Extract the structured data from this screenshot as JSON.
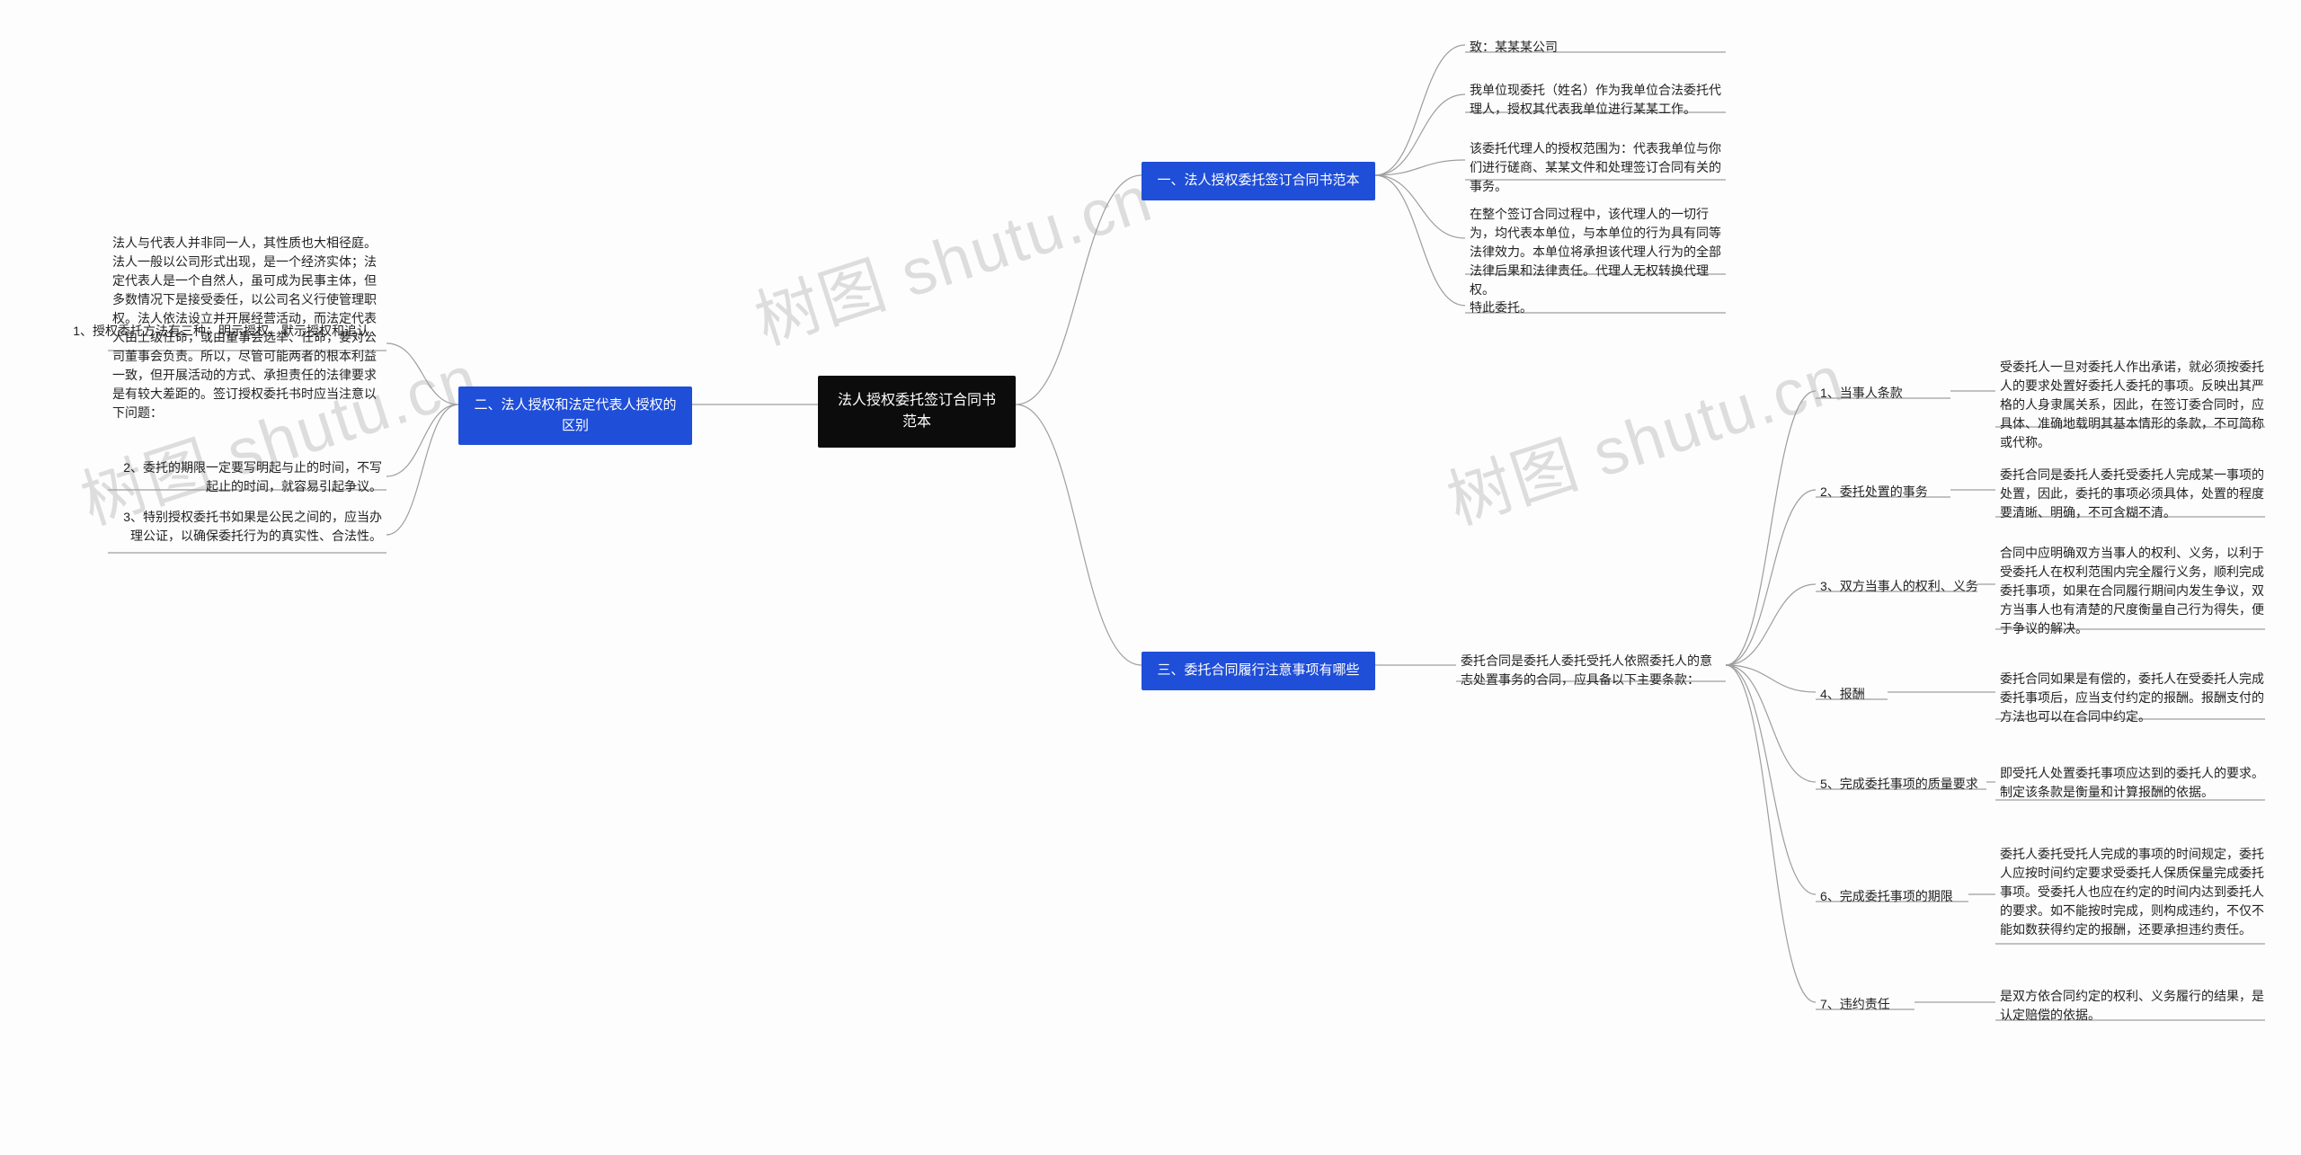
{
  "watermark": "树图 shutu.cn",
  "root": "法人授权委托签订合同书范本",
  "branches": {
    "b1": {
      "title": "一、法人授权委托签订合同书范本",
      "children": [
        "致：某某某公司",
        "我单位现委托（姓名）作为我单位合法委托代理人，授权其代表我单位进行某某工作。",
        "该委托代理人的授权范围为：代表我单位与你们进行磋商、某某文件和处理签订合同有关的事务。",
        "在整个签订合同过程中，该代理人的一切行为，均代表本单位，与本单位的行为具有同等法律效力。本单位将承担该代理人行为的全部法律后果和法律责任。代理人无权转换代理权。",
        "特此委托。"
      ]
    },
    "b2": {
      "title": "二、法人授权和法定代表人授权的区别",
      "desc": "法人与代表人并非同一人，其性质也大相径庭。法人一般以公司形式出现，是一个经济实体；法定代表人是一个自然人，虽可成为民事主体，但多数情况下是接受委任，以公司名义行使管理职权。法人依法设立并开展经营活动，而法定代表人由上级任命，或由董事会选举、任命，要对公司董事会负责。所以，尽管可能两者的根本利益一致，但开展活动的方式、承担责任的法律要求是有较大差距的。签订授权委托书时应当注意以下问题：",
      "children": [
        "1、授权委托方法有三种：明示授权、默示授权和追认。",
        "2、委托的期限一定要写明起与止的时间，不写起止的时间，就容易引起争议。",
        "3、特别授权委托书如果是公民之间的，应当办理公证，以确保委托行为的真实性、合法性。"
      ]
    },
    "b3": {
      "title": "三、委托合同履行注意事项有哪些",
      "intro": "委托合同是委托人委托受托人依照委托人的意志处置事务的合同，应具备以下主要条款：",
      "items": [
        {
          "k": "1、当事人条款",
          "v": "受委托人一旦对委托人作出承诺，就必须按委托人的要求处置好委托人委托的事项。反映出其严格的人身隶属关系，因此，在签订委合同时，应具体、准确地载明其基本情形的条款，不可简称或代称。"
        },
        {
          "k": "2、委托处置的事务",
          "v": "委托合同是委托人委托受委托人完成某一事项的处置，因此，委托的事项必须具体，处置的程度要清晰、明确，不可含糊不清。"
        },
        {
          "k": "3、双方当事人的权利、义务",
          "v": "合同中应明确双方当事人的权利、义务，以利于受委托人在权利范围内完全履行义务，顺利完成委托事项，如果在合同履行期间内发生争议，双方当事人也有清楚的尺度衡量自己行为得失，便于争议的解决。"
        },
        {
          "k": "4、报酬",
          "v": "委托合同如果是有偿的，委托人在受委托人完成委托事项后，应当支付约定的报酬。报酬支付的方法也可以在合同中约定。"
        },
        {
          "k": "5、完成委托事项的质量要求",
          "v": "即受托人处置委托事项应达到的委托人的要求。制定该条款是衡量和计算报酬的依据。"
        },
        {
          "k": "6、完成委托事项的期限",
          "v": "委托人委托受托人完成的事项的时间规定，委托人应按时间约定要求受委托人保质保量完成委托事项。受委托人也应在约定的时间内达到委托人的要求。如不能按时完成，则构成违约，不仅不能如数获得约定的报酬，还要承担违约责任。"
        },
        {
          "k": "7、违约责任",
          "v": "是双方依合同约定的权利、义务履行的结果，是认定赔偿的依据。"
        }
      ]
    }
  }
}
